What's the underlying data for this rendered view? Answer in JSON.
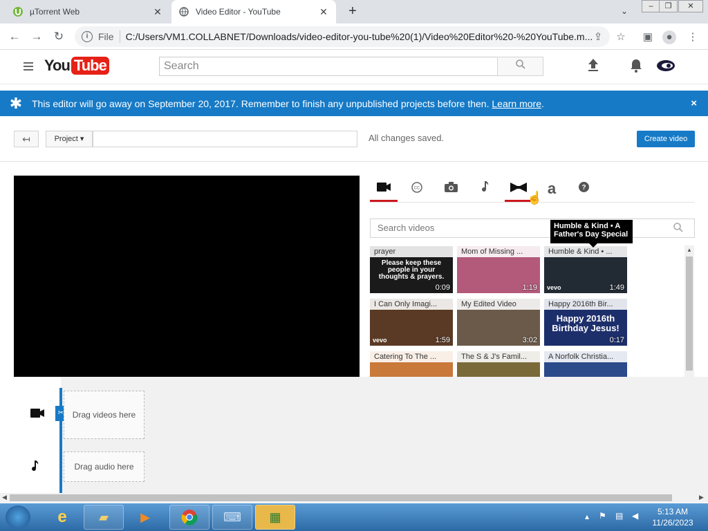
{
  "browser": {
    "tabs": [
      {
        "title": "µTorrent Web",
        "icon": "utorrent-icon"
      },
      {
        "title": "Video Editor - YouTube",
        "icon": "globe-icon"
      }
    ],
    "new_tab_label": "+",
    "close_label": "✕",
    "url_prefix": "File",
    "url": "C:/Users/VM1.COLLABNET/Downloads/video-editor-you-tube%20(1)/Video%20Editor%20-%20YouTube.m..."
  },
  "youtube": {
    "logo_you": "You",
    "logo_tube": "Tube",
    "search_placeholder": "Search"
  },
  "banner": {
    "text": "This editor will go away on September 20, 2017. Remember to finish any unpublished projects before then.",
    "link": "Learn more",
    "suffix": ".",
    "close": "×"
  },
  "project": {
    "button": "Project ▾",
    "status": "All changes saved.",
    "create_label": "Create video"
  },
  "media": {
    "search_placeholder": "Search videos",
    "tooltip": "Humble & Kind • A Father's Day Special",
    "videos": [
      {
        "title": "prayer",
        "duration": "0:09",
        "overlay": "Please keep these people in your thoughts & prayers.",
        "color": "#1a1a1a"
      },
      {
        "title": "Mom of Missing ...",
        "duration": "1:19",
        "overlay": "",
        "color": "#b35a7a"
      },
      {
        "title": "Humble & Kind • ...",
        "duration": "1:49",
        "overlay": "",
        "color": "#222a33"
      },
      {
        "title": "I Can Only Imagi...",
        "duration": "1:59",
        "overlay": "",
        "color": "#5a3a25"
      },
      {
        "title": "My Edited Video",
        "duration": "3:02",
        "overlay": "",
        "color": "#6b5a4a"
      },
      {
        "title": "Happy 2016th Bir...",
        "duration": "0:17",
        "overlay": "Happy 2016th Birthday Jesus!",
        "color": "#1d2f6b"
      },
      {
        "title": "Catering To The ...",
        "duration": "",
        "overlay": "",
        "color": "#c9793a"
      },
      {
        "title": "The S & J's Famil...",
        "duration": "",
        "overlay": "",
        "color": "#7a6a3a"
      },
      {
        "title": "A Norfolk Christia...",
        "duration": "",
        "overlay": "",
        "color": "#2a4a8a"
      }
    ]
  },
  "timeline": {
    "video_drop": "Drag videos here",
    "audio_drop": "Drag audio here"
  },
  "taskbar": {
    "time": "5:13 AM",
    "date": "11/26/2023"
  }
}
